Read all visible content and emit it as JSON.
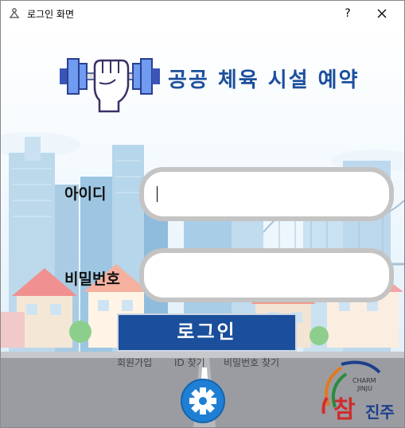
{
  "window": {
    "title": "로그인 화면",
    "help_label": "?"
  },
  "app": {
    "title": "공공 체육 시설 예약"
  },
  "form": {
    "id_label": "아이디",
    "id_value": "",
    "password_label": "비밀번호",
    "password_value": "",
    "login_label": "로그인"
  },
  "links": {
    "signup": "회원가입",
    "find_id": "ID 찾기",
    "find_password": "비밀번호 찾기"
  },
  "city_logo": {
    "small_text": "CHARM",
    "small_text2": "JINJU",
    "main_char": "참",
    "sub": "진주"
  },
  "colors": {
    "brand": "#1b4f9c",
    "sky": "#dff0fb",
    "road": "#8d8f94"
  },
  "icons": {
    "app": "dumbbell-icon",
    "settings": "gear-icon",
    "close": "close-icon"
  }
}
